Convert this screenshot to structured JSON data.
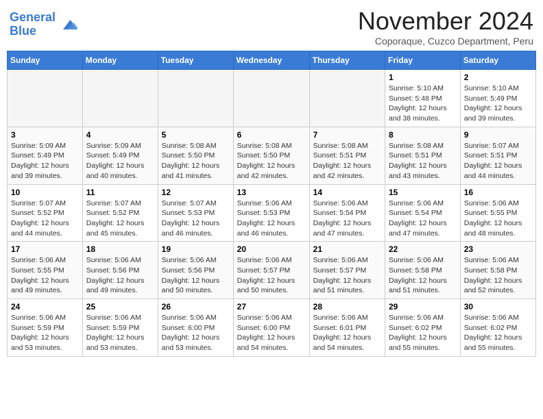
{
  "header": {
    "logo_line1": "General",
    "logo_line2": "Blue",
    "month_title": "November 2024",
    "subtitle": "Coporaque, Cuzco Department, Peru"
  },
  "weekdays": [
    "Sunday",
    "Monday",
    "Tuesday",
    "Wednesday",
    "Thursday",
    "Friday",
    "Saturday"
  ],
  "weeks": [
    [
      {
        "day": "",
        "info": "",
        "empty": true
      },
      {
        "day": "",
        "info": "",
        "empty": true
      },
      {
        "day": "",
        "info": "",
        "empty": true
      },
      {
        "day": "",
        "info": "",
        "empty": true
      },
      {
        "day": "",
        "info": "",
        "empty": true
      },
      {
        "day": "1",
        "info": "Sunrise: 5:10 AM\nSunset: 5:48 PM\nDaylight: 12 hours\nand 38 minutes.",
        "empty": false
      },
      {
        "day": "2",
        "info": "Sunrise: 5:10 AM\nSunset: 5:49 PM\nDaylight: 12 hours\nand 39 minutes.",
        "empty": false
      }
    ],
    [
      {
        "day": "3",
        "info": "Sunrise: 5:09 AM\nSunset: 5:49 PM\nDaylight: 12 hours\nand 39 minutes.",
        "empty": false
      },
      {
        "day": "4",
        "info": "Sunrise: 5:09 AM\nSunset: 5:49 PM\nDaylight: 12 hours\nand 40 minutes.",
        "empty": false
      },
      {
        "day": "5",
        "info": "Sunrise: 5:08 AM\nSunset: 5:50 PM\nDaylight: 12 hours\nand 41 minutes.",
        "empty": false
      },
      {
        "day": "6",
        "info": "Sunrise: 5:08 AM\nSunset: 5:50 PM\nDaylight: 12 hours\nand 42 minutes.",
        "empty": false
      },
      {
        "day": "7",
        "info": "Sunrise: 5:08 AM\nSunset: 5:51 PM\nDaylight: 12 hours\nand 42 minutes.",
        "empty": false
      },
      {
        "day": "8",
        "info": "Sunrise: 5:08 AM\nSunset: 5:51 PM\nDaylight: 12 hours\nand 43 minutes.",
        "empty": false
      },
      {
        "day": "9",
        "info": "Sunrise: 5:07 AM\nSunset: 5:51 PM\nDaylight: 12 hours\nand 44 minutes.",
        "empty": false
      }
    ],
    [
      {
        "day": "10",
        "info": "Sunrise: 5:07 AM\nSunset: 5:52 PM\nDaylight: 12 hours\nand 44 minutes.",
        "empty": false
      },
      {
        "day": "11",
        "info": "Sunrise: 5:07 AM\nSunset: 5:52 PM\nDaylight: 12 hours\nand 45 minutes.",
        "empty": false
      },
      {
        "day": "12",
        "info": "Sunrise: 5:07 AM\nSunset: 5:53 PM\nDaylight: 12 hours\nand 46 minutes.",
        "empty": false
      },
      {
        "day": "13",
        "info": "Sunrise: 5:06 AM\nSunset: 5:53 PM\nDaylight: 12 hours\nand 46 minutes.",
        "empty": false
      },
      {
        "day": "14",
        "info": "Sunrise: 5:06 AM\nSunset: 5:54 PM\nDaylight: 12 hours\nand 47 minutes.",
        "empty": false
      },
      {
        "day": "15",
        "info": "Sunrise: 5:06 AM\nSunset: 5:54 PM\nDaylight: 12 hours\nand 47 minutes.",
        "empty": false
      },
      {
        "day": "16",
        "info": "Sunrise: 5:06 AM\nSunset: 5:55 PM\nDaylight: 12 hours\nand 48 minutes.",
        "empty": false
      }
    ],
    [
      {
        "day": "17",
        "info": "Sunrise: 5:06 AM\nSunset: 5:55 PM\nDaylight: 12 hours\nand 49 minutes.",
        "empty": false
      },
      {
        "day": "18",
        "info": "Sunrise: 5:06 AM\nSunset: 5:56 PM\nDaylight: 12 hours\nand 49 minutes.",
        "empty": false
      },
      {
        "day": "19",
        "info": "Sunrise: 5:06 AM\nSunset: 5:56 PM\nDaylight: 12 hours\nand 50 minutes.",
        "empty": false
      },
      {
        "day": "20",
        "info": "Sunrise: 5:06 AM\nSunset: 5:57 PM\nDaylight: 12 hours\nand 50 minutes.",
        "empty": false
      },
      {
        "day": "21",
        "info": "Sunrise: 5:06 AM\nSunset: 5:57 PM\nDaylight: 12 hours\nand 51 minutes.",
        "empty": false
      },
      {
        "day": "22",
        "info": "Sunrise: 5:06 AM\nSunset: 5:58 PM\nDaylight: 12 hours\nand 51 minutes.",
        "empty": false
      },
      {
        "day": "23",
        "info": "Sunrise: 5:06 AM\nSunset: 5:58 PM\nDaylight: 12 hours\nand 52 minutes.",
        "empty": false
      }
    ],
    [
      {
        "day": "24",
        "info": "Sunrise: 5:06 AM\nSunset: 5:59 PM\nDaylight: 12 hours\nand 53 minutes.",
        "empty": false
      },
      {
        "day": "25",
        "info": "Sunrise: 5:06 AM\nSunset: 5:59 PM\nDaylight: 12 hours\nand 53 minutes.",
        "empty": false
      },
      {
        "day": "26",
        "info": "Sunrise: 5:06 AM\nSunset: 6:00 PM\nDaylight: 12 hours\nand 53 minutes.",
        "empty": false
      },
      {
        "day": "27",
        "info": "Sunrise: 5:06 AM\nSunset: 6:00 PM\nDaylight: 12 hours\nand 54 minutes.",
        "empty": false
      },
      {
        "day": "28",
        "info": "Sunrise: 5:06 AM\nSunset: 6:01 PM\nDaylight: 12 hours\nand 54 minutes.",
        "empty": false
      },
      {
        "day": "29",
        "info": "Sunrise: 5:06 AM\nSunset: 6:02 PM\nDaylight: 12 hours\nand 55 minutes.",
        "empty": false
      },
      {
        "day": "30",
        "info": "Sunrise: 5:06 AM\nSunset: 6:02 PM\nDaylight: 12 hours\nand 55 minutes.",
        "empty": false
      }
    ]
  ]
}
